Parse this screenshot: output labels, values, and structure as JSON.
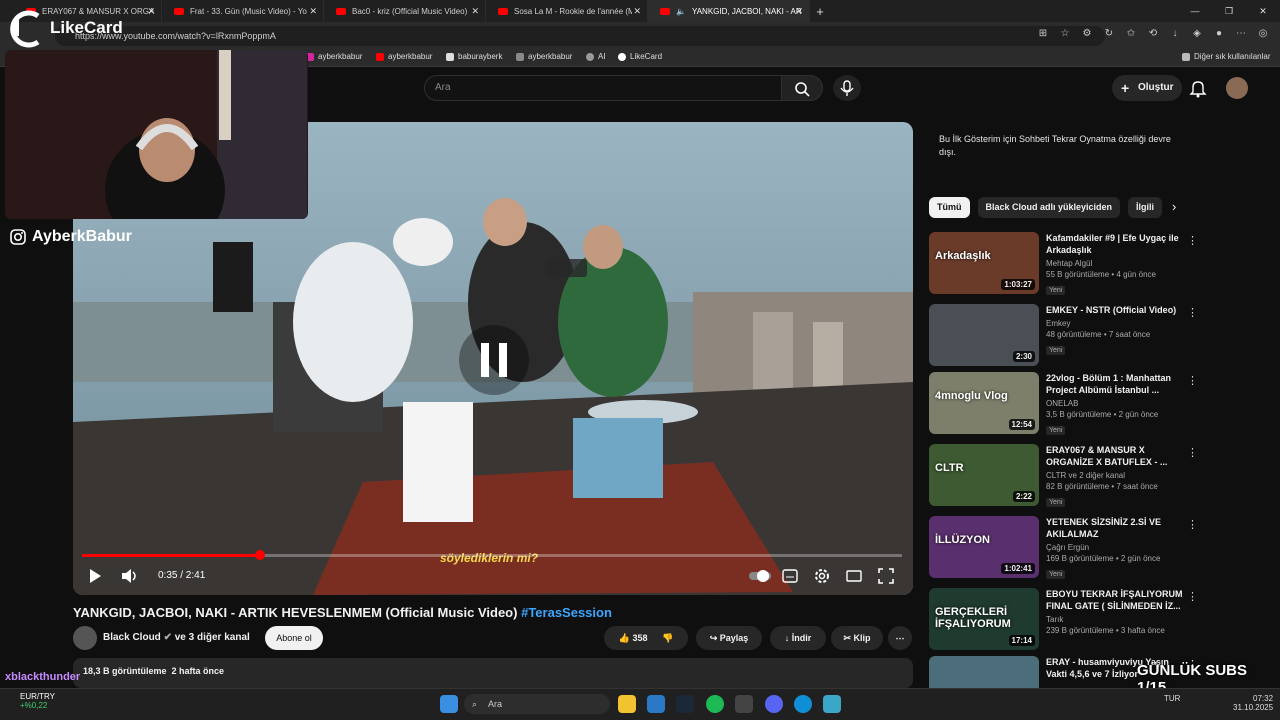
{
  "browser": {
    "tabs": [
      {
        "label": "ERAY067 & MANSUR X ORGANİZE"
      },
      {
        "label": "Frat - 33. Gün (Music Video) - Yo"
      },
      {
        "label": "Bac0 - kriz (Official Music Video)"
      },
      {
        "label": "Sosa La M - Rookie de l'année (M"
      },
      {
        "label": "YANKGID, JACBOI, NAKI - AR"
      }
    ],
    "new_tab": "+",
    "url": "https://www.youtube.com/watch?v=lRxnmPoppmA",
    "bookmarks": [
      "ayberkbabur",
      "ayberkbabur",
      "baburayberk",
      "ayberkbabur",
      "AI",
      "LikeCard"
    ],
    "other_bookmarks": "Diğer sık kullanılanlar"
  },
  "overlay": {
    "likecard_logo": "LikeCard",
    "handle": "AyberkBabur",
    "viewer_name": "xblackthunder",
    "subs_goal": "GÜNLÜK SUBS 1/15"
  },
  "youtube": {
    "search_placeholder": "Ara",
    "create_label": "Oluştur",
    "player": {
      "subtitle": "söylediklerin mi?",
      "time": "0:35 / 2:41",
      "progress_fraction": 0.2174
    },
    "video": {
      "title": "YANKGID, JACBOI, NAKI - ARTIK HEVESLENMEM (Official Music Video)",
      "hashtag": "#TerasSession",
      "channel": "Black Cloud",
      "channel_extra": "ve 3 diğer kanal",
      "subscribe": "Abone ol",
      "likes": "358",
      "share": "Paylaş",
      "download": "İndir",
      "clip": "Klip",
      "views": "18,3 B görüntüleme",
      "age": "2 hafta önce",
      "desc_line": "YANKGID, JACBOI, NAKI - ARTIK HEVESLENMEM"
    },
    "side_note": "Bu İlk Gösterim için Sohbeti Tekrar Oynatma özelliği devre dışı.",
    "chips": [
      "Tümü",
      "Black Cloud adlı yükleyiciden",
      "İlgili"
    ],
    "recommendations": [
      {
        "title": "Kafamdakiler #9 | Efe Uygaç ile Arkadaşlık",
        "channel": "Mehtap Algül",
        "meta": "55 B görüntüleme • 4 gün önce",
        "badge": "Yeni",
        "duration": "1:03:27",
        "thumb_text": "Arkadaşlık"
      },
      {
        "title": "EMKEY - NSTR (Official Video)",
        "channel": "Emkey",
        "meta": "48 görüntüleme • 7 saat önce",
        "badge": "Yeni",
        "duration": "2:30",
        "thumb_text": ""
      },
      {
        "title": "22vlog - Bölüm 1 : Manhattan Project Albümü İstanbul ...",
        "channel": "ONELAB",
        "meta": "3,5 B görüntüleme • 2 gün önce",
        "badge": "Yeni",
        "duration": "12:54",
        "thumb_text": "4mnoglu Vlog"
      },
      {
        "title": "ERAY067 & MANSUR X ORGANİZE X BATUFLEX - ...",
        "channel": "CLTR ve 2 diğer kanal",
        "meta": "82 B görüntüleme • 7 saat önce",
        "badge": "Yeni",
        "duration": "2:22",
        "thumb_text": "CLTR"
      },
      {
        "title": "YETENEK SİZSİNİZ 2.Sİ VE AKILALMAZ SİHİRBAZLIKLARI...",
        "channel": "Çağrı Ergün",
        "meta": "169 B görüntüleme • 2 gün önce",
        "badge": "Yeni",
        "duration": "1:02:41",
        "thumb_text": "İLLÜZYON"
      },
      {
        "title": "EBOYU TEKRAR İFŞALIYORUM FINAL GATE ( SİLİNMEDEN İZ...",
        "channel": "Tarık",
        "meta": "239 B görüntüleme • 3 hafta önce",
        "badge": "",
        "duration": "17:14",
        "thumb_text": "GERÇEKLERİ İFŞALIYORUM"
      },
      {
        "title": "ERAY - husamviyuviyu Yaşın Vakti 4,5,6 ve 7 İzliyor",
        "channel": "",
        "meta": "",
        "badge": "",
        "duration": "",
        "thumb_text": ""
      }
    ]
  },
  "taskbar": {
    "currency": "EUR/TRY",
    "change": "+%0,22",
    "search": "Ara",
    "lang": "TUR",
    "time": "07:32",
    "date": "31.10.2025"
  },
  "colors": {
    "accent_red": "#ff0000",
    "link_blue": "#3ea6ff",
    "subtitle_yellow": "#f4d84a"
  }
}
